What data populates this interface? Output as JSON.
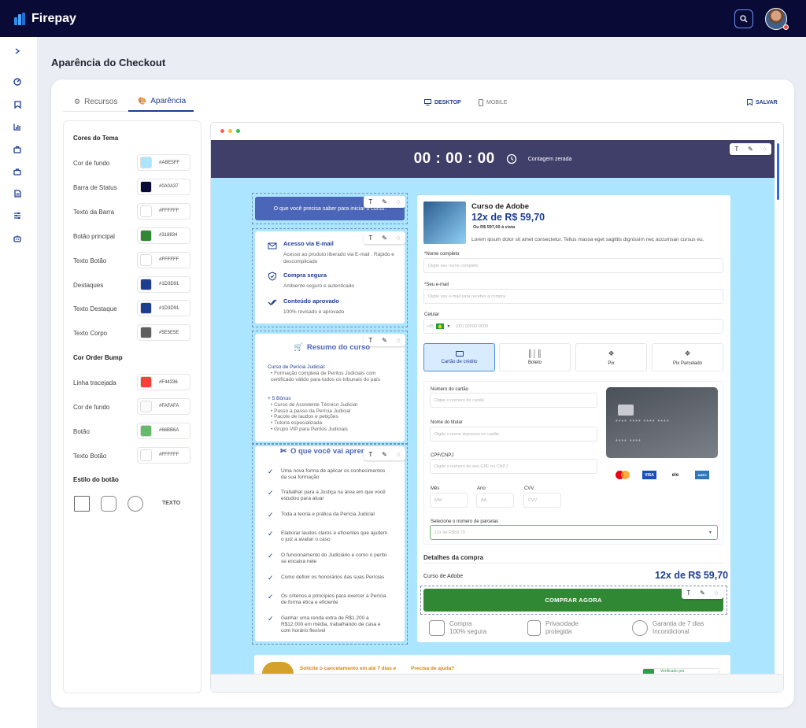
{
  "app": {
    "name": "Firepay"
  },
  "page": {
    "title": "Aparência do Checkout"
  },
  "tabs": [
    {
      "label": "Recursos"
    },
    {
      "label": "Aparência"
    }
  ],
  "views": {
    "desktop": "DESKTOP",
    "mobile": "MOBILE"
  },
  "save_label": "SALVAR",
  "theme_colors": {
    "section_title": "Cores do Tema",
    "items": [
      {
        "label": "Cor de fundo",
        "hex": "#ABE5FF"
      },
      {
        "label": "Barra de Status",
        "hex": "#0A0A37"
      },
      {
        "label": "Texto da Barra",
        "hex": "#FFFFFF"
      },
      {
        "label": "Botão principal",
        "hex": "#318834"
      },
      {
        "label": "Texto Botão",
        "hex": "#FFFFFF"
      },
      {
        "label": "Destaques",
        "hex": "#1D3D91"
      },
      {
        "label": "Texto Destaque",
        "hex": "#1D3D91"
      },
      {
        "label": "Texto Corpo",
        "hex": "#5E5E5E"
      }
    ]
  },
  "order_bump_colors": {
    "section_title": "Cor Order Bump",
    "items": [
      {
        "label": "Linha tracejada",
        "hex": "#F44336"
      },
      {
        "label": "Cor de fundo",
        "hex": "#FAFAFA"
      },
      {
        "label": "Botão",
        "hex": "#66BB6A"
      },
      {
        "label": "Texto Botão",
        "hex": "#FFFFFF"
      }
    ]
  },
  "button_style": {
    "section_title": "Estilo do botão",
    "text_option": "TEXTO"
  },
  "preview": {
    "timer": "00 : 00 : 00",
    "timer_label": "Contagem zerada",
    "intro_cta": "O que você precisa saber para iniciar o curso:",
    "features": [
      {
        "title": "Acesso via E-mail",
        "desc": "Acesso ao produto liberado via E-mail . Rápido e descomplicado"
      },
      {
        "title": "Compra segura",
        "desc": "Ambiente seguro e autenticado"
      },
      {
        "title": "Conteúdo aprovado",
        "desc": "100% revisado e aprovado"
      }
    ],
    "summary": {
      "title": "Resumo do curso",
      "course_name": "Curso de Perícia Judicial:",
      "course_bullets": [
        "Formação completa de Peritos Judiciais com certificado válido para todos os tribunais do país"
      ],
      "bonus_title": "+ 5 Bônus",
      "bonus_items": [
        "Curso de Assistente Técnico Judicial",
        "Passo a passo da Perícia Judicial",
        "Pacote de laudos e petições",
        "Tutoria especializada",
        "Grupo VIP para Peritos Judiciais"
      ]
    },
    "learn": {
      "title": "O que você vai apren",
      "items": [
        "Uma nova forma de aplicar os conhecimentos da sua formação",
        "Trabalhar para a Justiça na área em que você estudou para atuar",
        "Toda a teoria e prática da Perícia Judicial",
        "Elaborar laudos claros e eficientes que ajudem o juiz a avaliar o caso",
        "O funcionamento do Judiciário e como o perito se encaixa nele",
        "Como definir os honorários das suas Perícias",
        "Os critérios e princípios para exercer a Perícia de forma ética e eficiente",
        "Ganhar uma renda extra de R$1.200 a R$12.000 em média, trabalhando de casa e com horário flexível"
      ]
    },
    "product": {
      "name": "Curso de Adobe",
      "installments": "12x de R$ 59,70",
      "cash_price": "Ou R$ 597,00 à vista",
      "description": "Lorem ipsum dolor sit amet consectetur. Tellus massa eget sagittis dignissim nec accumsan cursus eu."
    },
    "form": {
      "name_label": "*Nome completo",
      "name_placeholder": "Digite seu nome completo",
      "email_label": "*Seu e-mail",
      "email_placeholder": "Digite seu e-mail para receber a compra",
      "phone_label": "Celular",
      "phone_code": "+55",
      "phone_placeholder": "(00) 00000-0000"
    },
    "payment_tabs": [
      "Cartão de crédito",
      "Boleto",
      "Pix",
      "Pix Parcelado"
    ],
    "card_form": {
      "number_label": "Número do cartão",
      "number_placeholder": "Digite o número do cartão",
      "holder_label": "Nome do titular",
      "holder_placeholder": "Digite o nome impresso no cartão",
      "doc_label": "CPF/CNPJ",
      "doc_placeholder": "Digite o número do seu CPF ou CNPJ",
      "month_label": "Mês",
      "month_placeholder": "MM",
      "year_label": "Ano",
      "year_placeholder": "AA",
      "cvv_label": "CVV",
      "cvv_placeholder": "CVV",
      "installments_label": "Selecione o número de parcelas",
      "installments_value": "12x de R$59,70"
    },
    "card_visual": {
      "row1": "**** **** **** ****",
      "row2": "**** ****"
    },
    "card_brands": [
      "mastercard",
      "VISA",
      "elo",
      "AMEX"
    ],
    "summary_box": {
      "title": "Detalhes da compra",
      "item": "Curso de Adobe",
      "total": "12x de R$ 59,70"
    },
    "buy_button": "COMPRAR AGORA",
    "trust": [
      {
        "line1": "Compra",
        "line2": "100% segura"
      },
      {
        "line1": "Privacidade",
        "line2": "protegida"
      },
      {
        "line1": "Garantia de 7 dias",
        "line2": "Incondicional"
      }
    ],
    "footer": {
      "cancel_text": "Solicite o cancelamento em até 7 dias e",
      "help_text": "Precisa de ajuda?",
      "verified": "Verificado por"
    }
  },
  "colors": {
    "brand": "#0A0A37",
    "accent": "#1D3D91",
    "checkout_bg": "#ABE5FF",
    "button": "#318834"
  }
}
